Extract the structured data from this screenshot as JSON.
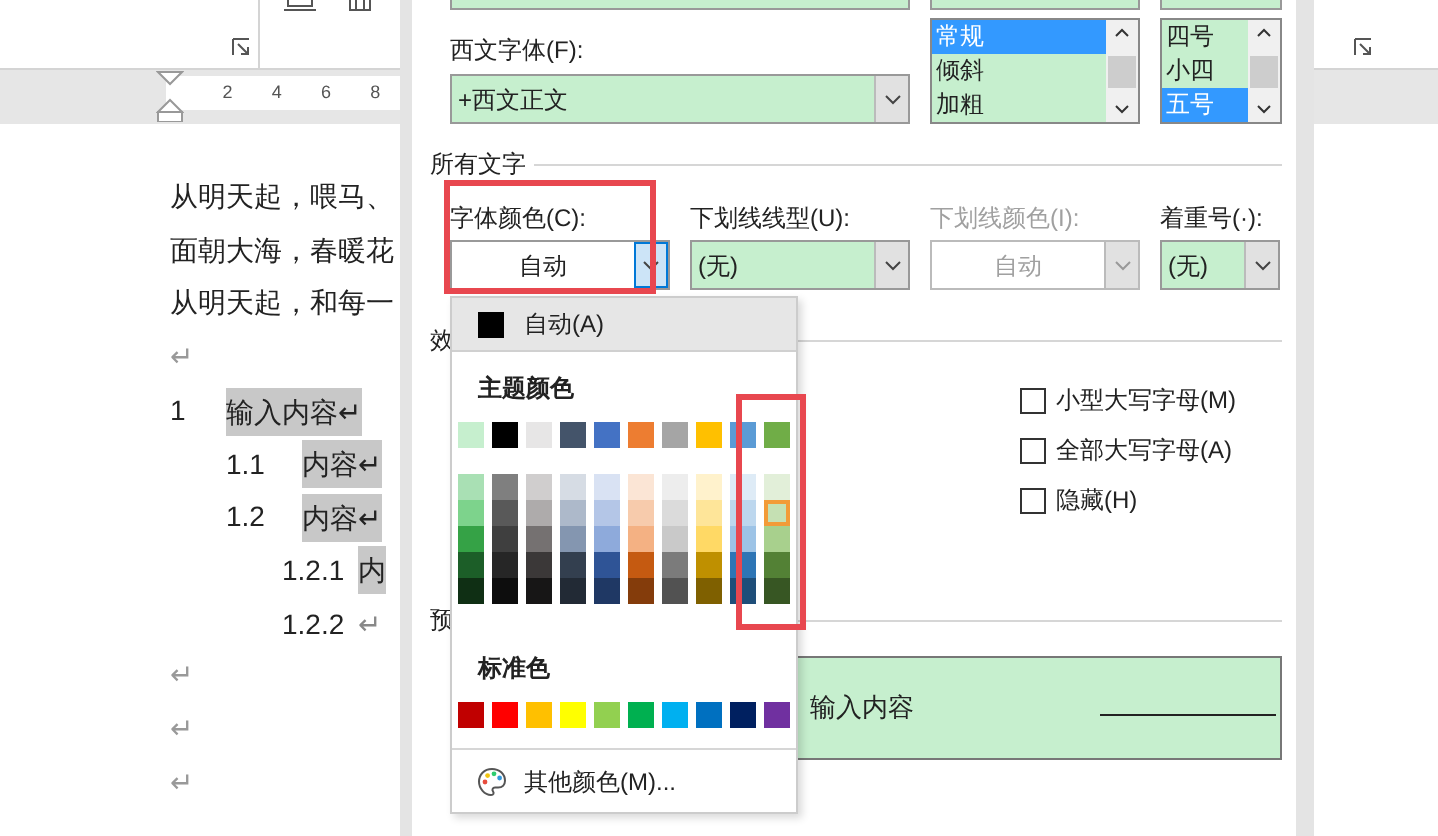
{
  "ruler": {
    "ticks": [
      "2",
      "4",
      "6",
      "8"
    ]
  },
  "document": {
    "paragraphs": [
      "从明天起，喂马、",
      "面朝大海，春暖花",
      "从明天起，和每一",
      "↵"
    ],
    "outline": [
      {
        "number": "1",
        "text": "输入内容↵",
        "selected": true,
        "children": [
          {
            "number": "1.1",
            "text": "内容↵",
            "selected": true
          },
          {
            "number": "1.2",
            "text": "内容↵",
            "selected": true,
            "children": [
              {
                "number": "1.2.1",
                "text": "内",
                "selected": true
              },
              {
                "number": "1.2.2",
                "text": "↵",
                "selected": false
              }
            ]
          }
        ]
      }
    ],
    "trailing_marks": [
      "↵",
      "↵",
      "↵"
    ]
  },
  "dialog": {
    "western_font": {
      "label": "西文字体(F):",
      "value": "+西文正文"
    },
    "style_list": [
      {
        "text": "常规",
        "selected": true
      },
      {
        "text": "倾斜",
        "selected": false
      },
      {
        "text": "加粗",
        "selected": false
      }
    ],
    "size_list": [
      {
        "text": "四号",
        "selected": false
      },
      {
        "text": "小四",
        "selected": false
      },
      {
        "text": "五号",
        "selected": true
      }
    ],
    "all_text_heading": "所有文字",
    "combos": [
      {
        "label": "字体颜色(C):",
        "value": "自动",
        "kind": "color",
        "disabled": false,
        "expanded": true
      },
      {
        "label": "下划线线型(U):",
        "value": "(无)",
        "kind": "list",
        "disabled": false,
        "expanded": false
      },
      {
        "label": "下划线颜色(I):",
        "value": "自动",
        "kind": "color",
        "disabled": true,
        "expanded": false
      },
      {
        "label": "着重号(·):",
        "value": "(无)",
        "kind": "list",
        "disabled": false,
        "expanded": false
      }
    ],
    "effects_heading": "效",
    "effects": [
      {
        "label": "小型大写字母(M)",
        "checked": false
      },
      {
        "label": "全部大写字母(A)",
        "checked": false
      },
      {
        "label": "隐藏(H)",
        "checked": false
      }
    ],
    "preview_heading": "预",
    "preview_text": "输入内容"
  },
  "color_menu": {
    "automatic": "自动(A)",
    "theme_heading": "主题颜色",
    "theme_colors": [
      {
        "color": "#c6efce",
        "shades": [
          {
            "color": "#a9e0b4",
            "selected": false
          },
          {
            "color": "#7dd38c",
            "selected": false
          },
          {
            "color": "#35a246",
            "selected": false
          },
          {
            "color": "#1c5e28",
            "selected": false
          },
          {
            "color": "#0f2f14",
            "selected": false
          }
        ]
      },
      {
        "color": "#000000",
        "shades": [
          {
            "color": "#7f7f7f",
            "selected": false
          },
          {
            "color": "#595959",
            "selected": false
          },
          {
            "color": "#3f3f3f",
            "selected": false
          },
          {
            "color": "#262626",
            "selected": false
          },
          {
            "color": "#0d0d0d",
            "selected": false
          }
        ]
      },
      {
        "color": "#e7e6e6",
        "shades": [
          {
            "color": "#d0cece",
            "selected": false
          },
          {
            "color": "#aeabab",
            "selected": false
          },
          {
            "color": "#757171",
            "selected": false
          },
          {
            "color": "#3b3838",
            "selected": false
          },
          {
            "color": "#171616",
            "selected": false
          }
        ]
      },
      {
        "color": "#44546a",
        "shades": [
          {
            "color": "#d6dce4",
            "selected": false
          },
          {
            "color": "#adb9ca",
            "selected": false
          },
          {
            "color": "#8496b0",
            "selected": false
          },
          {
            "color": "#333f4f",
            "selected": false
          },
          {
            "color": "#222a35",
            "selected": false
          }
        ]
      },
      {
        "color": "#4472c4",
        "shades": [
          {
            "color": "#d9e2f3",
            "selected": false
          },
          {
            "color": "#b4c6e7",
            "selected": false
          },
          {
            "color": "#8eaadb",
            "selected": false
          },
          {
            "color": "#2f5496",
            "selected": false
          },
          {
            "color": "#1f3864",
            "selected": false
          }
        ]
      },
      {
        "color": "#ed7d31",
        "shades": [
          {
            "color": "#fbe5d5",
            "selected": false
          },
          {
            "color": "#f7cbac",
            "selected": false
          },
          {
            "color": "#f4b183",
            "selected": false
          },
          {
            "color": "#c55a11",
            "selected": false
          },
          {
            "color": "#843c0b",
            "selected": false
          }
        ]
      },
      {
        "color": "#a5a5a5",
        "shades": [
          {
            "color": "#ededed",
            "selected": false
          },
          {
            "color": "#dbdbdb",
            "selected": false
          },
          {
            "color": "#c9c9c9",
            "selected": false
          },
          {
            "color": "#7b7b7b",
            "selected": false
          },
          {
            "color": "#525252",
            "selected": false
          }
        ]
      },
      {
        "color": "#ffc000",
        "shades": [
          {
            "color": "#fff2cc",
            "selected": false
          },
          {
            "color": "#fee599",
            "selected": false
          },
          {
            "color": "#ffd965",
            "selected": false
          },
          {
            "color": "#bf9000",
            "selected": false
          },
          {
            "color": "#7f6000",
            "selected": false
          }
        ]
      },
      {
        "color": "#5b9bd5",
        "shades": [
          {
            "color": "#deebf6",
            "selected": false
          },
          {
            "color": "#bdd7ee",
            "selected": false
          },
          {
            "color": "#9dc3e6",
            "selected": false
          },
          {
            "color": "#2e75b5",
            "selected": false
          },
          {
            "color": "#1f4e79",
            "selected": false
          }
        ]
      },
      {
        "color": "#70ad47",
        "shades": [
          {
            "color": "#e2efd9",
            "selected": false
          },
          {
            "color": "#c5e0b3",
            "selected": true
          },
          {
            "color": "#a8d08d",
            "selected": false
          },
          {
            "color": "#538135",
            "selected": false
          },
          {
            "color": "#375623",
            "selected": false
          }
        ]
      }
    ],
    "standard_heading": "标准色",
    "standard_colors": [
      {
        "color": "#c00000"
      },
      {
        "color": "#ff0000"
      },
      {
        "color": "#ffc000"
      },
      {
        "color": "#ffff00"
      },
      {
        "color": "#92d050"
      },
      {
        "color": "#00b050"
      },
      {
        "color": "#00b0f0"
      },
      {
        "color": "#0070c0"
      },
      {
        "color": "#002060"
      },
      {
        "color": "#7030a0"
      }
    ],
    "more_colors": "其他颜色(M)..."
  }
}
